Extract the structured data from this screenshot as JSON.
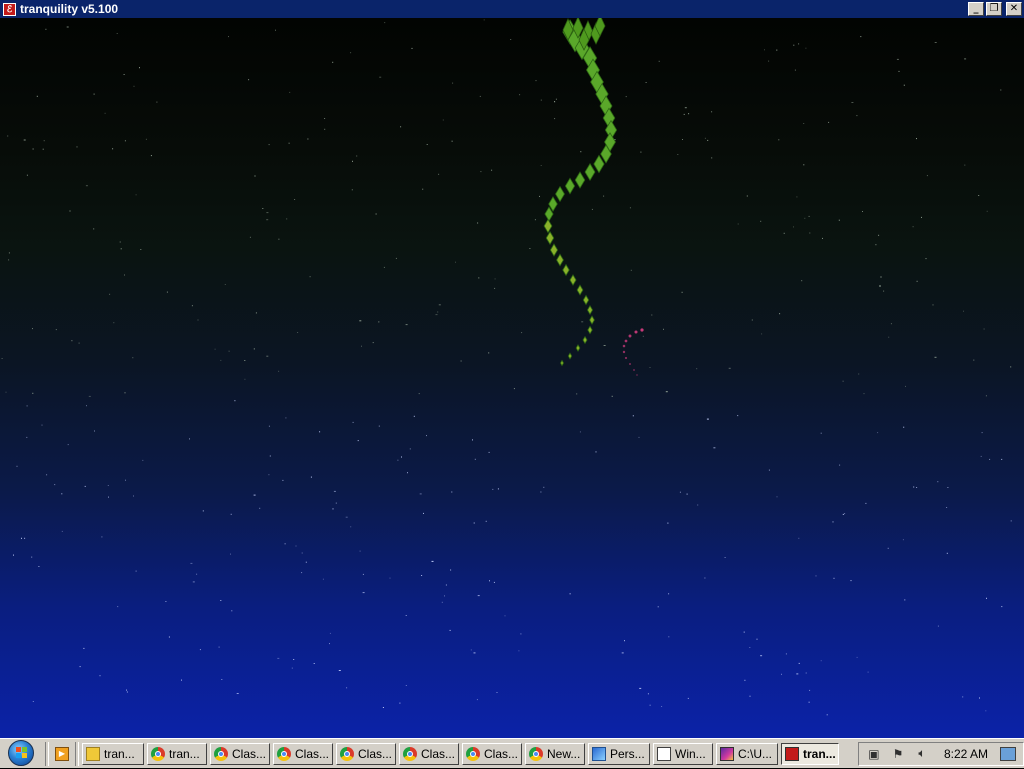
{
  "window": {
    "title": "tranquility v5.100",
    "icon": "app-icon",
    "controls": {
      "minimize": "_",
      "restore": "❐",
      "close": "✕"
    }
  },
  "scene": {
    "description_colors": {
      "sky_top": "#020402",
      "sky_bottom": "#0b22a8",
      "vine": "#5aa82a",
      "vine_dark": "#2e6a14",
      "comet": "#c83a7a"
    }
  },
  "taskbar": {
    "start_icon": "windows-start-orb",
    "quick_launch": [
      {
        "icon": "media-player-icon"
      }
    ],
    "buttons": [
      {
        "label": "tran...",
        "icon": "folder",
        "active": false
      },
      {
        "label": "tran...",
        "icon": "chrome",
        "active": false
      },
      {
        "label": "Clas...",
        "icon": "chrome",
        "active": false
      },
      {
        "label": "Clas...",
        "icon": "chrome",
        "active": false
      },
      {
        "label": "Clas...",
        "icon": "chrome",
        "active": false
      },
      {
        "label": "Clas...",
        "icon": "chrome",
        "active": false
      },
      {
        "label": "Clas...",
        "icon": "chrome",
        "active": false
      },
      {
        "label": "New...",
        "icon": "chrome",
        "active": false
      },
      {
        "label": "Pers...",
        "icon": "pers",
        "active": false
      },
      {
        "label": "Win...",
        "icon": "win",
        "active": false
      },
      {
        "label": "C:\\U...",
        "icon": "cmd",
        "active": false
      },
      {
        "label": "tran...",
        "icon": "tran",
        "active": true
      }
    ],
    "tray": {
      "icons": [
        "network-icon",
        "flag-icon",
        "volume-icon"
      ],
      "clock": "8:22 AM"
    }
  }
}
